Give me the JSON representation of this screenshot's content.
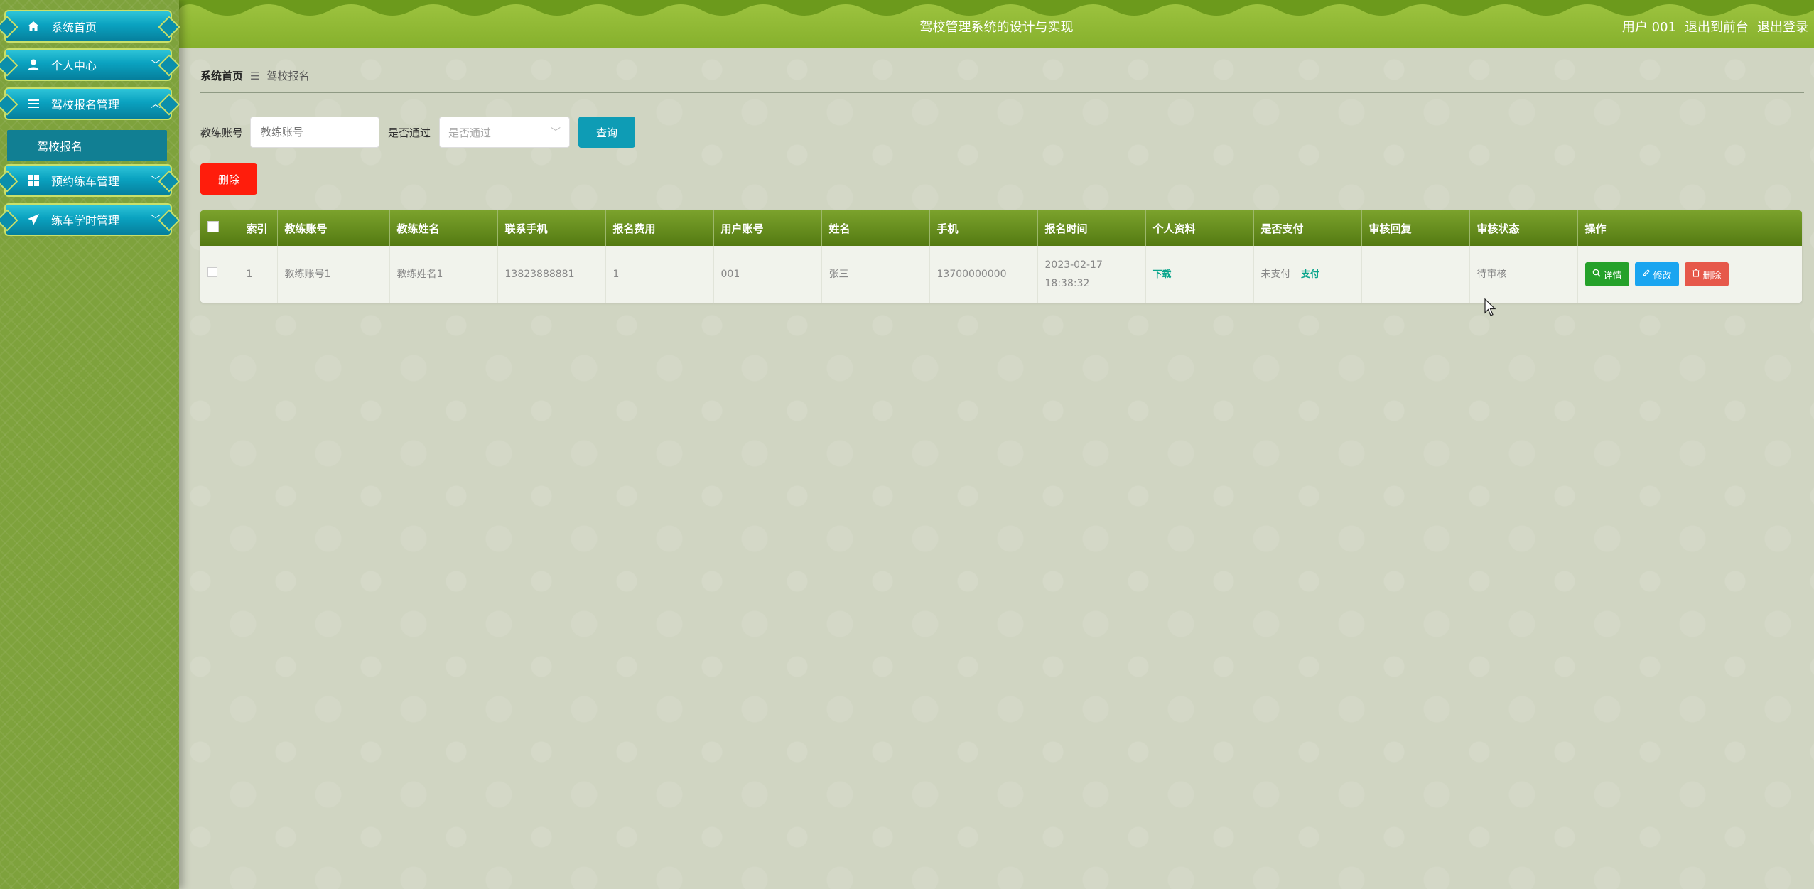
{
  "sidebar": {
    "items": [
      {
        "label": "系统首页",
        "icon": "home-icon"
      },
      {
        "label": "个人中心",
        "icon": "user-icon"
      },
      {
        "label": "驾校报名管理",
        "icon": "list-icon"
      },
      {
        "label": "预约练车管理",
        "icon": "grid-icon"
      },
      {
        "label": "练车学时管理",
        "icon": "paper-plane-icon"
      }
    ],
    "submenu": {
      "label": "驾校报名"
    }
  },
  "header": {
    "title": "驾校管理系统的设计与实现",
    "user": "用户 001",
    "to_front": "退出到前台",
    "logout": "退出登录"
  },
  "breadcrumb": {
    "home": "系统首页",
    "sep": "☰",
    "current": "驾校报名"
  },
  "search": {
    "coach_label": "教练账号",
    "coach_placeholder": "教练账号",
    "pass_label": "是否通过",
    "pass_placeholder": "是否通过",
    "query_button": "查询"
  },
  "delete_button": "删除",
  "table": {
    "columns": [
      "",
      "索引",
      "教练账号",
      "教练姓名",
      "联系手机",
      "报名费用",
      "用户账号",
      "姓名",
      "手机",
      "报名时间",
      "个人资料",
      "是否支付",
      "审核回复",
      "审核状态",
      "操作"
    ],
    "rows": [
      {
        "index": "1",
        "coach_account": "教练账号1",
        "coach_name": "教练姓名1",
        "contact_phone": "13823888881",
        "fee": "1",
        "user_account": "001",
        "name": "张三",
        "phone": "13700000000",
        "signup_time": "2023-02-17 18:38:32",
        "profile": "下载",
        "paid_status": "未支付",
        "pay_link": "支付",
        "review_reply": "",
        "review_status": "待审核",
        "ops": {
          "detail": "详情",
          "edit": "修改",
          "delete": "删除"
        }
      }
    ]
  },
  "colors": {
    "header_green": "#8ab530",
    "sidebar_green": "#7ea23c",
    "menu_teal": "#0aa2c0",
    "query_button": "#0e9cb5",
    "delete_red": "#ff1d0c"
  }
}
